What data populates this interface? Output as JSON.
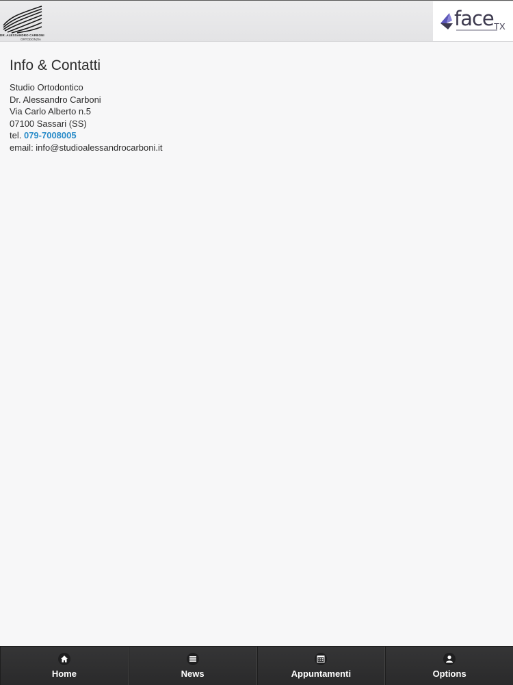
{
  "header": {
    "left_logo": {
      "icon": "wave-stripes-logo",
      "line1": "DR. ALESSANDRO CARBONI",
      "line2": "ORTODONZIA"
    },
    "right_logo": {
      "icon": "facetx-logo",
      "face": "face",
      "tx": "TX"
    }
  },
  "main": {
    "title": "Info & Contatti",
    "lines": [
      "Studio Ortodontico",
      "Dr. Alessandro Carboni",
      "Via Carlo Alberto n.5",
      "07100 Sassari (SS)"
    ],
    "tel_prefix": "tel.",
    "tel_number": "079-7008005",
    "email_line": "email: info@studioalessandrocarboni.it"
  },
  "tabbar": {
    "tabs": [
      {
        "label": "Home",
        "icon": "home-icon"
      },
      {
        "label": "News",
        "icon": "menu-lines-icon"
      },
      {
        "label": "Appuntamenti",
        "icon": "calendar-icon"
      },
      {
        "label": "Options",
        "icon": "user-icon"
      }
    ]
  },
  "colors": {
    "link": "#2a8cc9",
    "tabbar_bg": "#2b2b2c",
    "page_bg": "#f7f7f8",
    "brand_purple": "#3d3a4f",
    "brand_accent": "#6b62c8"
  }
}
